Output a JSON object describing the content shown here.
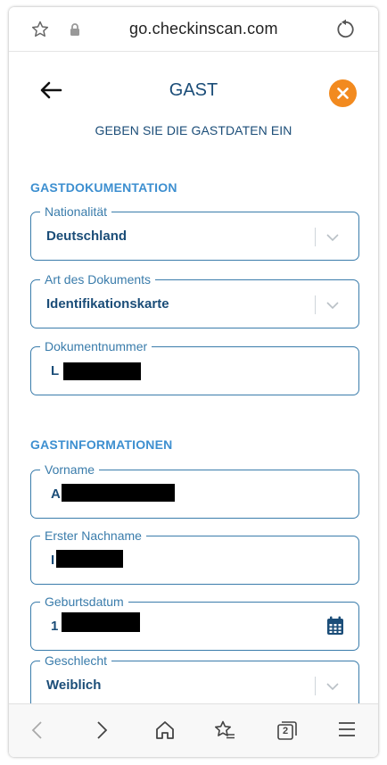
{
  "browser": {
    "url": "go.checkinscan.com",
    "tab_count": "2"
  },
  "header": {
    "title": "GAST",
    "subtitle": "GEBEN SIE DIE GASTDATEN EIN"
  },
  "document_section": {
    "heading": "GASTDOKUMENTATION",
    "nationality": {
      "label": "Nationalität",
      "value": "Deutschland"
    },
    "document_type": {
      "label": "Art des Dokuments",
      "value": "Identifikationskarte"
    },
    "document_number": {
      "label": "Dokumentnummer",
      "value_visible": "L"
    }
  },
  "guest_section": {
    "heading": "GASTINFORMATIONEN",
    "first_name": {
      "label": "Vorname",
      "value_visible": "A"
    },
    "last_name": {
      "label": "Erster Nachname",
      "value_visible": "I"
    },
    "birth_date": {
      "label": "Geburtsdatum",
      "value_visible": "1"
    },
    "gender": {
      "label": "Geschlecht",
      "value": "Weiblich"
    }
  },
  "colors": {
    "primary": "#1b4d78",
    "accent": "#3d8fd0",
    "field_border": "#3a7cab",
    "close": "#f28a1f"
  }
}
